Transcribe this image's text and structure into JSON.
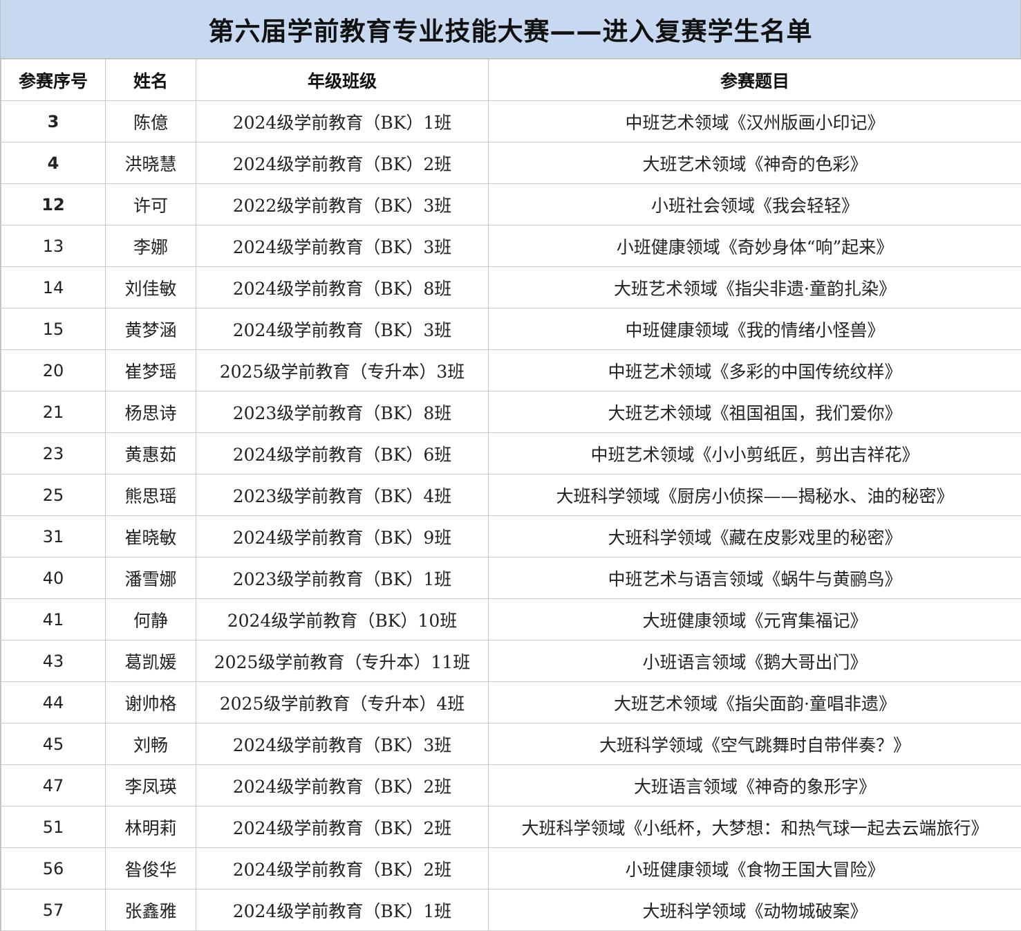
{
  "title": "第六届学前教育专业技能大赛——进入复赛学生名单",
  "headers": [
    "参赛序号",
    "姓名",
    "年级班级",
    "参赛题目"
  ],
  "rows": [
    {
      "seq": "3",
      "name": "陈億",
      "class": "2024级学前教育（BK）1班",
      "topic": "中班艺术领域《汉州版画小印记》"
    },
    {
      "seq": "4",
      "name": "洪晓慧",
      "class": "2024级学前教育（BK）2班",
      "topic": "大班艺术领域《神奇的色彩》"
    },
    {
      "seq": "12",
      "name": "许可",
      "class": "2022级学前教育（BK）3班",
      "topic": "小班社会领域《我会轻轻》"
    },
    {
      "seq": "13",
      "name": "李娜",
      "class": "2024级学前教育（BK）3班",
      "topic": "小班健康领域《奇妙身体“响”起来》"
    },
    {
      "seq": "14",
      "name": "刘佳敏",
      "class": "2024级学前教育（BK）8班",
      "topic": "大班艺术领域《指尖非遗·童韵扎染》"
    },
    {
      "seq": "15",
      "name": "黄梦涵",
      "class": "2024级学前教育（BK）3班",
      "topic": "中班健康领域《我的情绪小怪兽》"
    },
    {
      "seq": "20",
      "name": "崔梦瑶",
      "class": "2025级学前教育（专升本）3班",
      "topic": "中班艺术领域《多彩的中国传统纹样》"
    },
    {
      "seq": "21",
      "name": "杨思诗",
      "class": "2023级学前教育（BK）8班",
      "topic": "大班艺术领域《祖国祖国，我们爱你》"
    },
    {
      "seq": "23",
      "name": "黄惠茹",
      "class": "2024级学前教育（BK）6班",
      "topic": "中班艺术领域《小小剪纸匠，剪出吉祥花》"
    },
    {
      "seq": "25",
      "name": "熊思瑶",
      "class": "2023级学前教育（BK）4班",
      "topic": "大班科学领域《厨房小侦探——揭秘水、油的秘密》"
    },
    {
      "seq": "31",
      "name": "崔晓敏",
      "class": "2024级学前教育（BK）9班",
      "topic": "大班科学领域《藏在皮影戏里的秘密》"
    },
    {
      "seq": "40",
      "name": "潘雪娜",
      "class": "2023级学前教育（BK）1班",
      "topic": "中班艺术与语言领域《蜗牛与黄鹂鸟》"
    },
    {
      "seq": "41",
      "name": "何静",
      "class": "2024级学前教育（BK）10班",
      "topic": "大班健康领域《元宵集福记》"
    },
    {
      "seq": "43",
      "name": "葛凯媛",
      "class": "2025级学前教育（专升本）11班",
      "topic": "小班语言领域《鹅大哥出门》"
    },
    {
      "seq": "44",
      "name": "谢帅格",
      "class": "2025级学前教育（专升本）4班",
      "topic": "大班艺术领域《指尖面韵·童唱非遗》"
    },
    {
      "seq": "45",
      "name": "刘畅",
      "class": "2024级学前教育（BK）3班",
      "topic": "大班科学领域《空气跳舞时自带伴奏？》"
    },
    {
      "seq": "47",
      "name": "李凤瑛",
      "class": "2024级学前教育（BK）2班",
      "topic": "大班语言领域《神奇的象形字》"
    },
    {
      "seq": "51",
      "name": "林明莉",
      "class": "2024级学前教育（BK）2班",
      "topic": "大班科学领域《小纸杯，大梦想：和热气球一起去云端旅行》"
    },
    {
      "seq": "56",
      "name": "昝俊华",
      "class": "2024级学前教育（BK）2班",
      "topic": "小班健康领域《食物王国大冒险》"
    },
    {
      "seq": "57",
      "name": "张鑫雅",
      "class": "2024级学前教育（BK）1班",
      "topic": "大班科学领域《动物城破案》"
    }
  ]
}
